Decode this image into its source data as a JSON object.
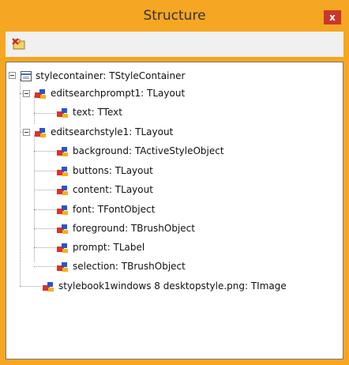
{
  "window": {
    "title": "Structure",
    "close_label": "x"
  },
  "tree": {
    "root": "stylecontainer: TStyleContainer",
    "nodes": [
      {
        "label": "editsearchprompt1: TLayout"
      },
      {
        "label": "text: TText"
      },
      {
        "label": "editsearchstyle1: TLayout"
      },
      {
        "label": "background: TActiveStyleObject"
      },
      {
        "label": "buttons: TLayout"
      },
      {
        "label": "content: TLayout"
      },
      {
        "label": "font: TFontObject"
      },
      {
        "label": "foreground: TBrushObject"
      },
      {
        "label": "prompt: TLabel"
      },
      {
        "label": "selection: TBrushObject"
      },
      {
        "label": "stylebook1windows 8 desktopstyle.png: TImage"
      }
    ]
  },
  "colors": {
    "accent": "#f5a623",
    "close": "#c9372c"
  }
}
